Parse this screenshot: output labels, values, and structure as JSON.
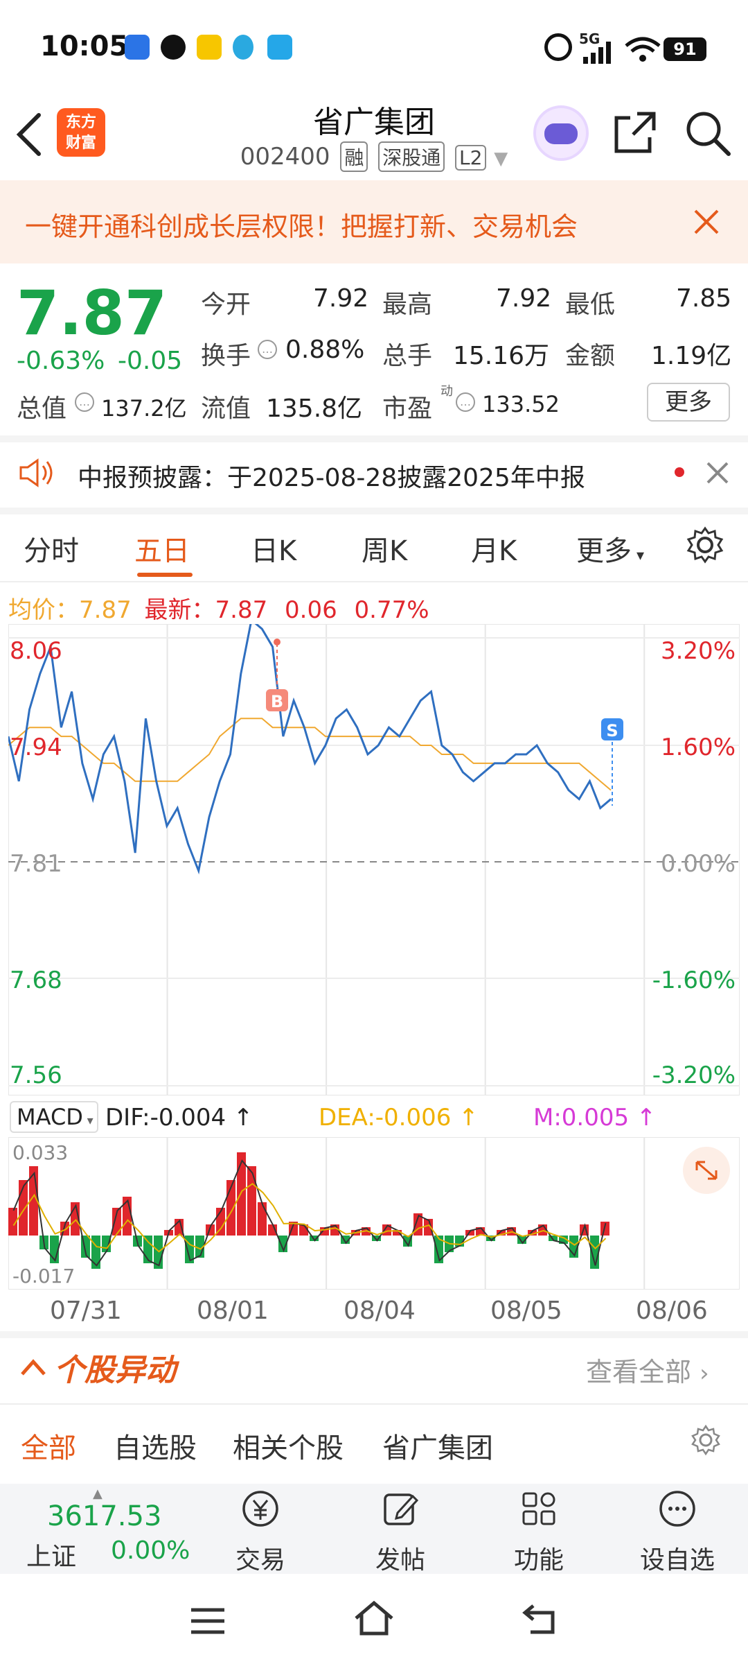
{
  "status_bar": {
    "time": "10:05",
    "battery": "91",
    "network": "5G"
  },
  "header": {
    "back_icon": "chevron-left-icon",
    "logo_line1": "东方",
    "logo_line2": "财富",
    "title": "省广集团",
    "code": "002400",
    "tags": [
      "融",
      "深股通",
      "L2"
    ],
    "share_icon": "share-icon",
    "search_icon": "search-icon"
  },
  "promo": {
    "text": "一键开通科创成长层权限！把握打新、交易机会"
  },
  "quote": {
    "price": "7.87",
    "change_pct": "-0.63%",
    "change": "-0.05",
    "open_label": "今开",
    "open": "7.92",
    "high_label": "最高",
    "high": "7.92",
    "low_label": "最低",
    "low": "7.85",
    "turnover_label": "换手",
    "turnover": "0.88%",
    "volume_label": "总手",
    "volume": "15.16万",
    "amount_label": "金额",
    "amount": "1.19亿",
    "mktcap_label": "总值",
    "mktcap": "137.2亿",
    "float_label": "流值",
    "float_cap": "135.8亿",
    "pe_label": "市盈",
    "pe_sup": "动",
    "pe": "133.52",
    "more_label": "更多"
  },
  "notice": {
    "text": "中报预披露：于2025-08-28披露2025年中报"
  },
  "tabs": [
    {
      "label": "分时"
    },
    {
      "label": "五日"
    },
    {
      "label": "日K"
    },
    {
      "label": "周K"
    },
    {
      "label": "月K"
    },
    {
      "label": "更多"
    }
  ],
  "legend": {
    "avg_label": "均价：",
    "avg": "7.87",
    "latest_label": "最新：",
    "latest": "7.87",
    "chg": "0.06",
    "chg_pct": "0.77%"
  },
  "chart_data": {
    "type": "line",
    "y_left_ticks": [
      "8.06",
      "7.94",
      "7.81",
      "7.68",
      "7.56"
    ],
    "y_right_ticks": [
      "3.20%",
      "1.60%",
      "0.00%",
      "-1.60%",
      "-3.20%"
    ],
    "x_labels": [
      "07/31",
      "08/01",
      "08/04",
      "08/05",
      "08/06"
    ],
    "ylim": [
      7.56,
      8.06
    ],
    "baseline": 7.81,
    "price_series": [
      7.95,
      7.9,
      7.98,
      8.02,
      8.05,
      7.96,
      8.0,
      7.92,
      7.88,
      7.93,
      7.95,
      7.9,
      7.82,
      7.97,
      7.9,
      7.85,
      7.87,
      7.83,
      7.8,
      7.86,
      7.9,
      7.93,
      8.02,
      8.08,
      8.07,
      8.05,
      7.95,
      7.99,
      7.96,
      7.92,
      7.94,
      7.97,
      7.98,
      7.96,
      7.93,
      7.94,
      7.96,
      7.95,
      7.97,
      7.99,
      8.0,
      7.94,
      7.93,
      7.91,
      7.9,
      7.91,
      7.92,
      7.92,
      7.93,
      7.93,
      7.94,
      7.92,
      7.91,
      7.89,
      7.88,
      7.9,
      7.87,
      7.88
    ],
    "avg_series": [
      7.94,
      7.95,
      7.96,
      7.96,
      7.96,
      7.95,
      7.95,
      7.94,
      7.93,
      7.92,
      7.92,
      7.91,
      7.9,
      7.9,
      7.9,
      7.9,
      7.9,
      7.91,
      7.92,
      7.93,
      7.95,
      7.96,
      7.97,
      7.97,
      7.97,
      7.96,
      7.96,
      7.96,
      7.96,
      7.96,
      7.95,
      7.95,
      7.95,
      7.95,
      7.95,
      7.95,
      7.95,
      7.95,
      7.95,
      7.94,
      7.94,
      7.93,
      7.93,
      7.93,
      7.92,
      7.92,
      7.92,
      7.92,
      7.92,
      7.92,
      7.92,
      7.92,
      7.92,
      7.92,
      7.92,
      7.91,
      7.9,
      7.89
    ],
    "markers": [
      {
        "label": "B"
      },
      {
        "label": "S"
      }
    ]
  },
  "macd": {
    "selector": "MACD",
    "dif": "DIF:-0.004",
    "dea": "DEA:-0.006",
    "m": "M:0.005",
    "top": "0.033",
    "bottom": "-0.017",
    "expand_icon": "expand-icon",
    "hist": [
      0.01,
      0.02,
      0.025,
      -0.005,
      -0.01,
      0.005,
      0.012,
      -0.008,
      -0.012,
      -0.006,
      0.01,
      0.014,
      -0.004,
      -0.01,
      -0.012,
      0.002,
      0.006,
      -0.01,
      -0.008,
      0.004,
      0.01,
      0.02,
      0.03,
      0.025,
      0.012,
      0.004,
      -0.006,
      0.005,
      0.004,
      -0.002,
      0.003,
      0.004,
      -0.003,
      0.002,
      0.003,
      -0.002,
      0.004,
      0.002,
      -0.004,
      0.008,
      0.006,
      -0.01,
      -0.006,
      -0.004,
      0.002,
      0.003,
      -0.002,
      0.002,
      0.003,
      -0.003,
      0.002,
      0.004,
      -0.002,
      -0.003,
      -0.008,
      0.004,
      -0.012,
      0.005
    ]
  },
  "section": {
    "title": "个股异动",
    "view_all": "查看全部",
    "sub_tabs": [
      "全部",
      "自选股",
      "相关个股",
      "省广集团"
    ]
  },
  "bottom_bar": {
    "index_value": "3617.53",
    "index_name": "上证",
    "index_pct": "0.00%",
    "items": [
      {
        "label": "交易",
        "icon": "yuan-icon"
      },
      {
        "label": "发帖",
        "icon": "edit-icon"
      },
      {
        "label": "功能",
        "icon": "grid-icon"
      },
      {
        "label": "设自选",
        "icon": "more-icon"
      }
    ]
  }
}
